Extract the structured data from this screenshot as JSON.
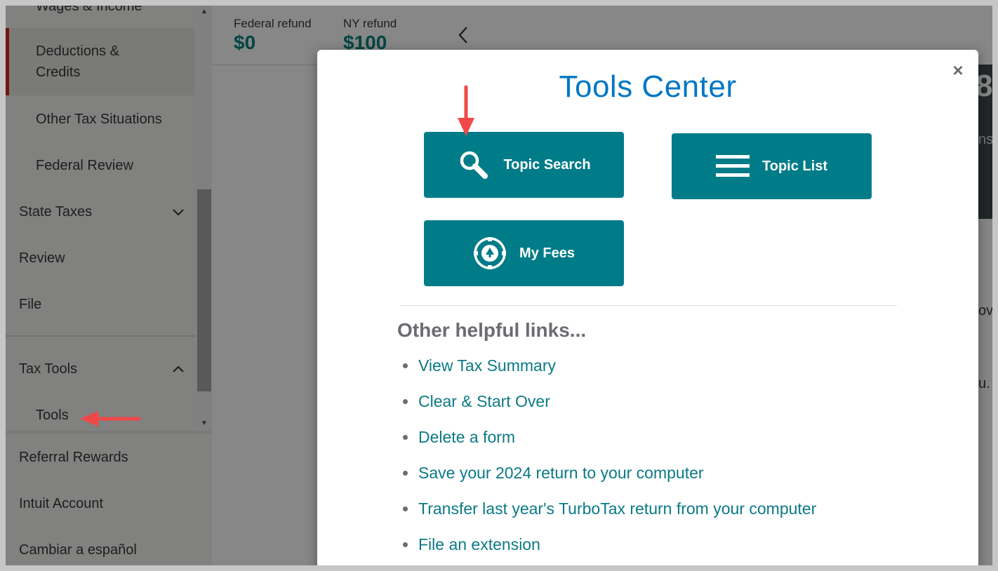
{
  "sidebar": {
    "items": [
      {
        "label": "Wages & Income"
      },
      {
        "label": "Deductions & Credits"
      },
      {
        "label": "Other Tax Situations"
      },
      {
        "label": "Federal Review"
      },
      {
        "label": "State Taxes"
      },
      {
        "label": "Review"
      },
      {
        "label": "File"
      },
      {
        "label": "Tax Tools"
      },
      {
        "label": "Tools"
      }
    ],
    "footer_items": [
      {
        "label": "Referral Rewards"
      },
      {
        "label": "Intuit Account"
      },
      {
        "label": "Cambiar a español"
      }
    ]
  },
  "header": {
    "federal_label": "Federal refund",
    "federal_amount": "$0",
    "state_label": "NY refund",
    "state_amount": "$100"
  },
  "background_peek": {
    "top_char": "8",
    "side_text": "ns",
    "text_1": "ov",
    "text_2": "u."
  },
  "modal": {
    "title": "Tools Center",
    "close_label": "×",
    "buttons": {
      "topic_search": "Topic Search",
      "topic_list": "Topic List",
      "my_fees": "My Fees"
    },
    "links_heading": "Other helpful links...",
    "links": [
      "View Tax Summary",
      "Clear & Start Over",
      "Delete a form",
      "Save your 2024 return to your computer",
      "Transfer last year's TurboTax return from your computer",
      "File an extension"
    ]
  },
  "colors": {
    "accent_teal": "#007b88",
    "title_blue": "#0077c5",
    "link_teal": "#0b7a85",
    "active_marker": "#d52b1e",
    "annotation_arrow": "#f04848"
  }
}
